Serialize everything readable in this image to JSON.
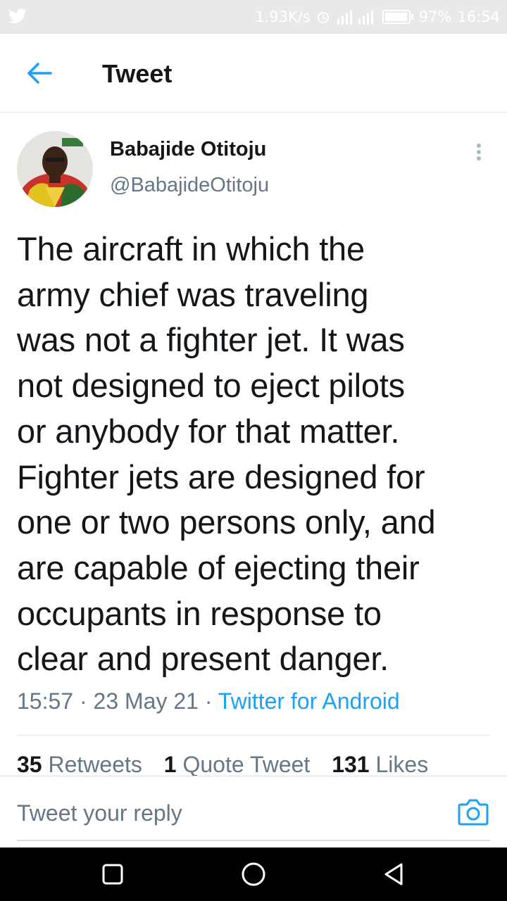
{
  "status_bar": {
    "speed": "1.93K/s",
    "battery": "97%",
    "time": "16:54"
  },
  "header": {
    "title": "Tweet"
  },
  "tweet": {
    "author_name": "Babajide Otitoju",
    "author_handle": "@BabajideOtitoju",
    "text": "The aircraft in which the\narmy chief was traveling\nwas not a fighter jet. It was\nnot designed to eject pilots\nor anybody for that matter.\nFighter jets are designed for\none or two persons only, and\nare capable of ejecting their\noccupants in response to\nclear and present danger.",
    "time": "15:57",
    "date": "23 May 21",
    "source": "Twitter for Android",
    "separator": "·"
  },
  "stats": {
    "retweets_count": "35",
    "retweets_label": "Retweets",
    "quotes_count": "1",
    "quotes_label": "Quote Tweet",
    "likes_count": "131",
    "likes_label": "Likes"
  },
  "reply": {
    "placeholder": "Tweet your reply"
  },
  "icons": {
    "app": "twitter-bird-icon",
    "back": "arrow-left-icon",
    "more": "more-vertical-icon",
    "camera": "camera-icon",
    "nav_recent": "square-icon",
    "nav_home": "circle-icon",
    "nav_back": "triangle-back-icon"
  },
  "colors": {
    "accent": "#1da1f2",
    "text": "#14171a",
    "secondary": "#657786"
  }
}
